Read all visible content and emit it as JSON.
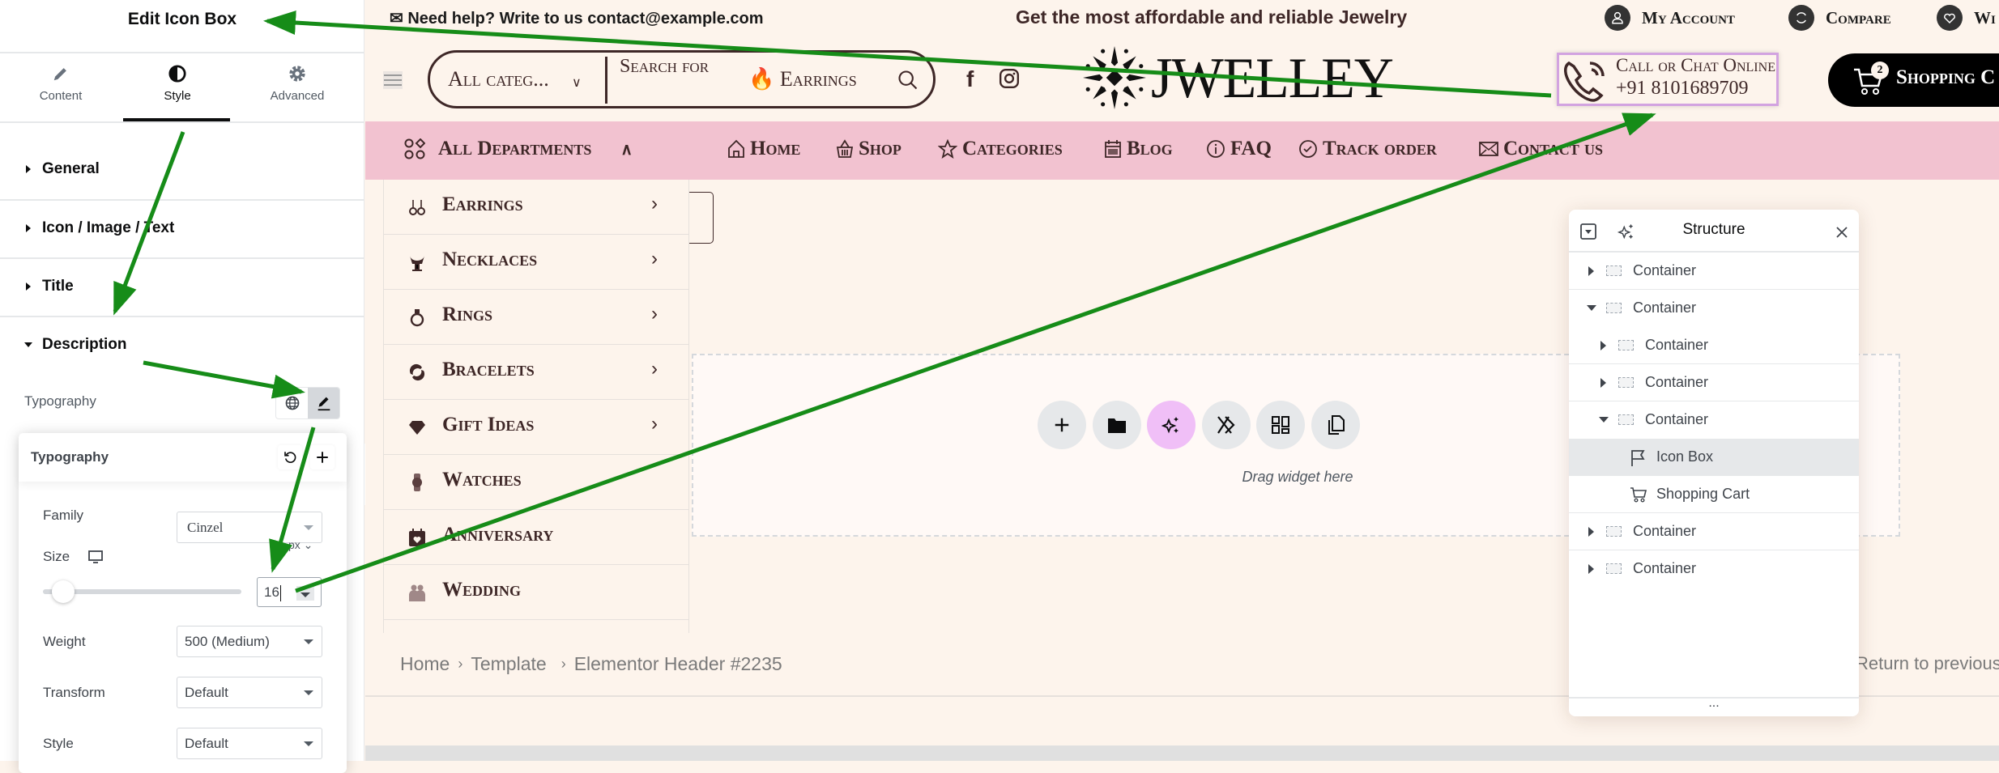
{
  "left_panel": {
    "title": "Edit Icon Box",
    "tabs": [
      {
        "label": "Content",
        "icon": "pencil-icon"
      },
      {
        "label": "Style",
        "icon": "half-circle-icon",
        "active": true
      },
      {
        "label": "Advanced",
        "icon": "gear-icon"
      }
    ],
    "sections": [
      {
        "label": "General",
        "expanded": false
      },
      {
        "label": "Icon / Image / Text",
        "expanded": false
      },
      {
        "label": "Title",
        "expanded": false
      },
      {
        "label": "Description",
        "expanded": true
      }
    ],
    "typography_label": "Typography",
    "typography_popover": {
      "title": "Typography",
      "family_label": "Family",
      "family_value": "Cinzel",
      "size_label": "Size",
      "size_unit": "px",
      "size_value": "16",
      "size_slider_fraction": 0.05,
      "weight_label": "Weight",
      "weight_value": "500 (Medium)",
      "transform_label": "Transform",
      "transform_value": "Default",
      "style_label": "Style",
      "style_value": "Default"
    }
  },
  "site": {
    "topbar": {
      "help_text": "✉ Need help? Write to us contact@example.com",
      "tagline": "Get the most affordable and reliable Jewelry",
      "links": [
        {
          "label": "My Account",
          "icon": "user-icon"
        },
        {
          "label": "Compare",
          "icon": "refresh-icon"
        },
        {
          "label": "Wi",
          "icon": "heart-icon"
        }
      ]
    },
    "header": {
      "category_select": "All categ...",
      "search_placeholder": "Search for",
      "search_hot": "🔥 Earrings",
      "logo_text": "JWELLEY",
      "call_title": "Call or Chat Online",
      "call_number": "+91 8101689709",
      "cart_label": "Shopping C",
      "cart_count": "2"
    },
    "nav": {
      "departments_label": "All Departments",
      "items": [
        {
          "label": "Home",
          "icon": "home-icon"
        },
        {
          "label": "Shop",
          "icon": "basket-icon"
        },
        {
          "label": "Categories",
          "icon": "star-icon"
        },
        {
          "label": "Blog",
          "icon": "calendar-icon"
        },
        {
          "label": "FAQ",
          "icon": "info-icon"
        },
        {
          "label": "Track order",
          "icon": "check-circle-icon"
        },
        {
          "label": "Contact us",
          "icon": "envelope-icon"
        }
      ]
    },
    "departments": [
      {
        "label": "Earrings",
        "has_sub": true
      },
      {
        "label": "Necklaces",
        "has_sub": true
      },
      {
        "label": "Rings",
        "has_sub": true
      },
      {
        "label": "Bracelets",
        "has_sub": true
      },
      {
        "label": "Gift Ideas",
        "has_sub": true
      },
      {
        "label": "Watches",
        "has_sub": false
      },
      {
        "label": "Anniversary",
        "has_sub": false
      },
      {
        "label": "Wedding",
        "has_sub": false
      }
    ],
    "dropzone_text": "Drag widget here",
    "breadcrumb": [
      "Home",
      "Template",
      "Elementor Header #2235"
    ],
    "return_link": "Return to previous"
  },
  "structure_panel": {
    "title": "Structure",
    "items": [
      {
        "label": "Container",
        "level": 0,
        "state": "collapsed"
      },
      {
        "label": "Container",
        "level": 0,
        "state": "expanded"
      },
      {
        "label": "Container",
        "level": 1,
        "state": "collapsed"
      },
      {
        "label": "Container",
        "level": 1,
        "state": "collapsed"
      },
      {
        "label": "Container",
        "level": 1,
        "state": "expanded"
      },
      {
        "label": "Icon Box",
        "level": 2,
        "state": "leaf",
        "selected": true
      },
      {
        "label": "Shopping Cart",
        "level": 2,
        "state": "leaf"
      },
      {
        "label": "Container",
        "level": 0,
        "state": "collapsed"
      },
      {
        "label": "Container",
        "level": 0,
        "state": "collapsed"
      }
    ],
    "footer": "..."
  },
  "colors": {
    "brand_brown": "#3e2727",
    "nav_pink": "#f2c2d0",
    "page_bg": "#fdf4ec",
    "highlight_purple": "#d2a3e0",
    "ai_pink": "#f0bff7",
    "annotation_green": "#168c18"
  }
}
